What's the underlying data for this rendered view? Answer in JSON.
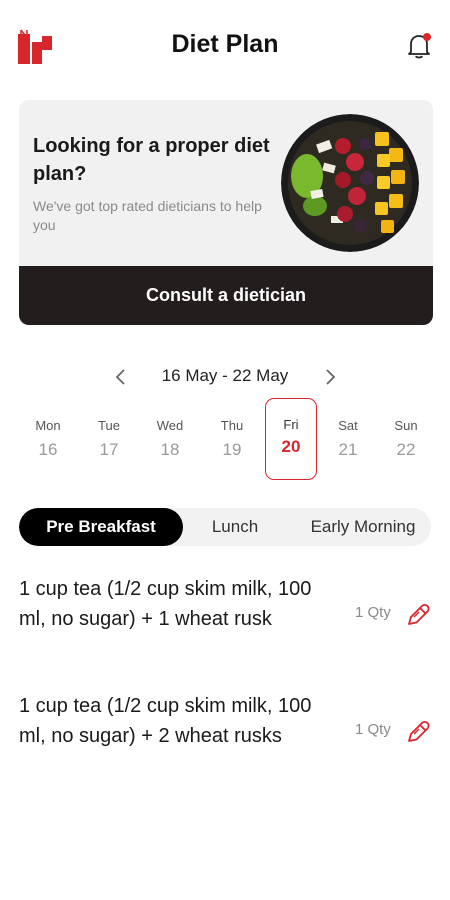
{
  "header": {
    "title": "Diet Plan",
    "logo_icon": "brand-logo",
    "bell_icon": "bell-icon",
    "accent_color": "#d8262d"
  },
  "promo": {
    "heading": "Looking for a proper diet plan?",
    "subtext": "We've got top rated dieticians to help you",
    "image": "fruit-bowl-image",
    "button_label": "Consult a dietician"
  },
  "week": {
    "range": "16 May - 22 May",
    "days": [
      {
        "name": "Mon",
        "num": "16"
      },
      {
        "name": "Tue",
        "num": "17"
      },
      {
        "name": "Wed",
        "num": "18"
      },
      {
        "name": "Thu",
        "num": "19"
      },
      {
        "name": "Fri",
        "num": "20",
        "selected": true
      },
      {
        "name": "Sat",
        "num": "21"
      },
      {
        "name": "Sun",
        "num": "22"
      }
    ]
  },
  "tabs": [
    {
      "label": "Pre Breakfast",
      "active": true
    },
    {
      "label": "Lunch"
    },
    {
      "label": "Early Morning"
    }
  ],
  "meals": [
    {
      "text": "1 cup tea (1/2 cup skim milk, 100 ml, no sugar) + 1 wheat rusk",
      "qty": "1 Qty"
    },
    {
      "text": "1 cup tea (1/2 cup skim milk, 100 ml, no sugar) + 2 wheat rusks",
      "qty": "1 Qty"
    }
  ]
}
